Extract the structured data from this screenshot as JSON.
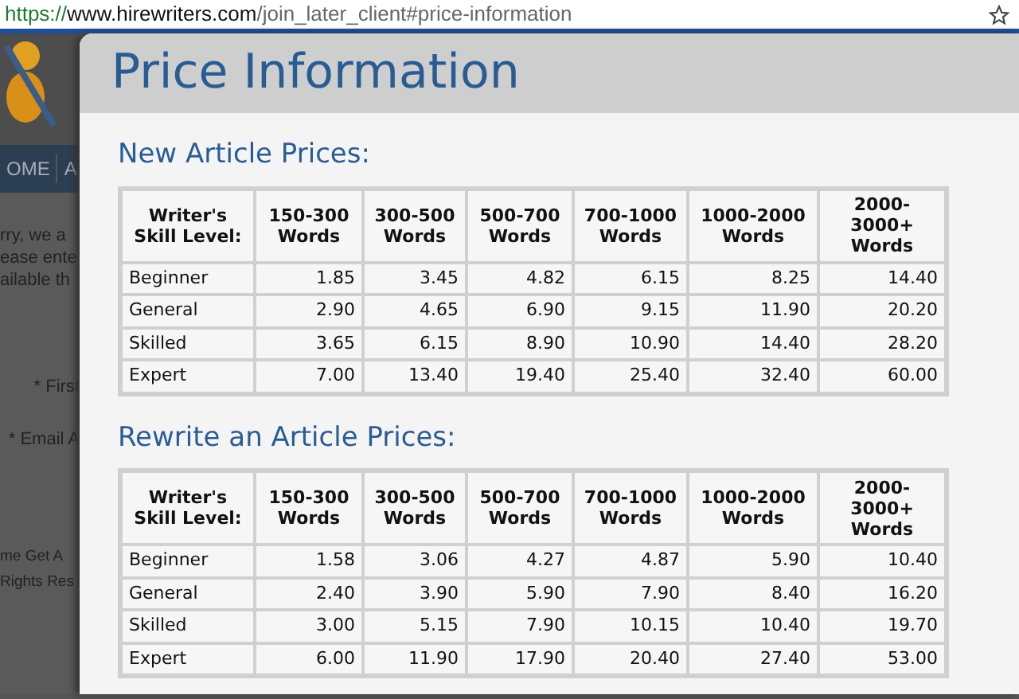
{
  "address_bar": {
    "scheme": "https://",
    "host": "www.hirewriters.com",
    "path": "/join_later_client#price-information"
  },
  "background_page": {
    "nav": [
      "OME",
      "A"
    ],
    "texts": [
      "rry, we a",
      "ease ente",
      "ailable th"
    ],
    "fields": [
      "* First",
      "* Email A"
    ],
    "footer": [
      "me  Get A",
      "Rights Res"
    ]
  },
  "modal": {
    "title": "Price Information",
    "sections": [
      {
        "heading": "New Article Prices:",
        "columns": [
          "Writer's Skill Level:",
          "150-300 Words",
          "300-500 Words",
          "500-700 Words",
          "700-1000 Words",
          "1000-2000 Words",
          "2000-3000+ Words"
        ],
        "rows": [
          [
            "Beginner",
            "1.85",
            "3.45",
            "4.82",
            "6.15",
            "8.25",
            "14.40"
          ],
          [
            "General",
            "2.90",
            "4.65",
            "6.90",
            "9.15",
            "11.90",
            "20.20"
          ],
          [
            "Skilled",
            "3.65",
            "6.15",
            "8.90",
            "10.90",
            "14.40",
            "28.20"
          ],
          [
            "Expert",
            "7.00",
            "13.40",
            "19.40",
            "25.40",
            "32.40",
            "60.00"
          ]
        ]
      },
      {
        "heading": "Rewrite an Article Prices:",
        "columns": [
          "Writer's Skill Level:",
          "150-300 Words",
          "300-500 Words",
          "500-700 Words",
          "700-1000 Words",
          "1000-2000 Words",
          "2000-3000+ Words"
        ],
        "rows": [
          [
            "Beginner",
            "1.58",
            "3.06",
            "4.27",
            "4.87",
            "5.90",
            "10.40"
          ],
          [
            "General",
            "2.40",
            "3.90",
            "5.90",
            "7.90",
            "8.40",
            "16.20"
          ],
          [
            "Skilled",
            "3.00",
            "5.15",
            "7.90",
            "10.15",
            "10.40",
            "19.70"
          ],
          [
            "Expert",
            "6.00",
            "11.90",
            "17.90",
            "20.40",
            "27.40",
            "53.00"
          ]
        ]
      }
    ]
  }
}
